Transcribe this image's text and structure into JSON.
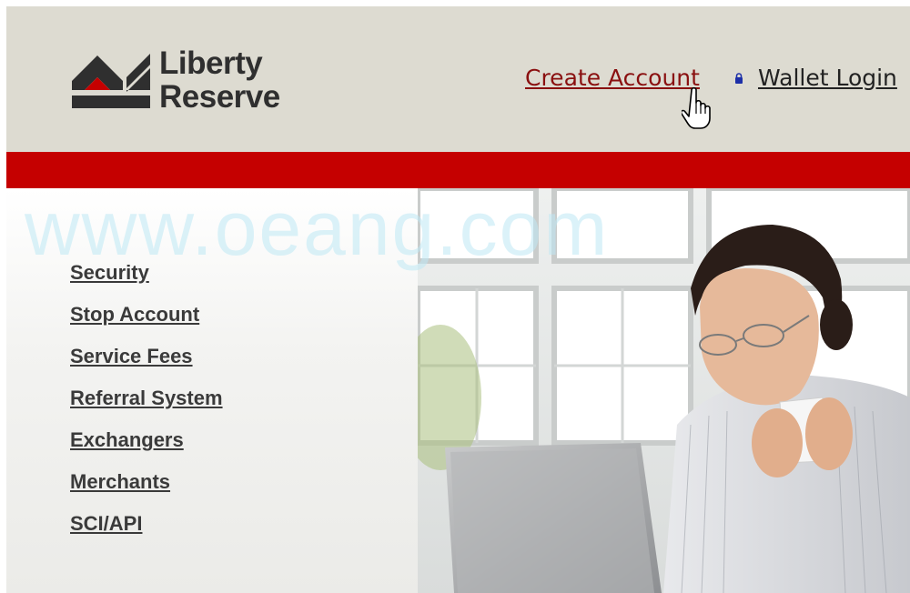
{
  "brand": {
    "line1": "Liberty",
    "line2": "Reserve"
  },
  "header_nav": {
    "create_account": "Create Account",
    "wallet_login": "Wallet Login"
  },
  "sidebar": {
    "items": [
      {
        "label": "Security"
      },
      {
        "label": "Stop Account"
      },
      {
        "label": "Service Fees"
      },
      {
        "label": "Referral System"
      },
      {
        "label": "Exchangers"
      },
      {
        "label": "Merchants"
      },
      {
        "label": "SCI/API"
      }
    ]
  },
  "watermark": "www.oeang.com",
  "colors": {
    "header_bg": "#dddbd1",
    "accent_red": "#c50000",
    "link_dark": "#3a3a3a",
    "create_link": "#8a1010"
  },
  "icons": [
    "liberty-reserve-logo-icon",
    "lock-icon",
    "hand-cursor-icon"
  ]
}
